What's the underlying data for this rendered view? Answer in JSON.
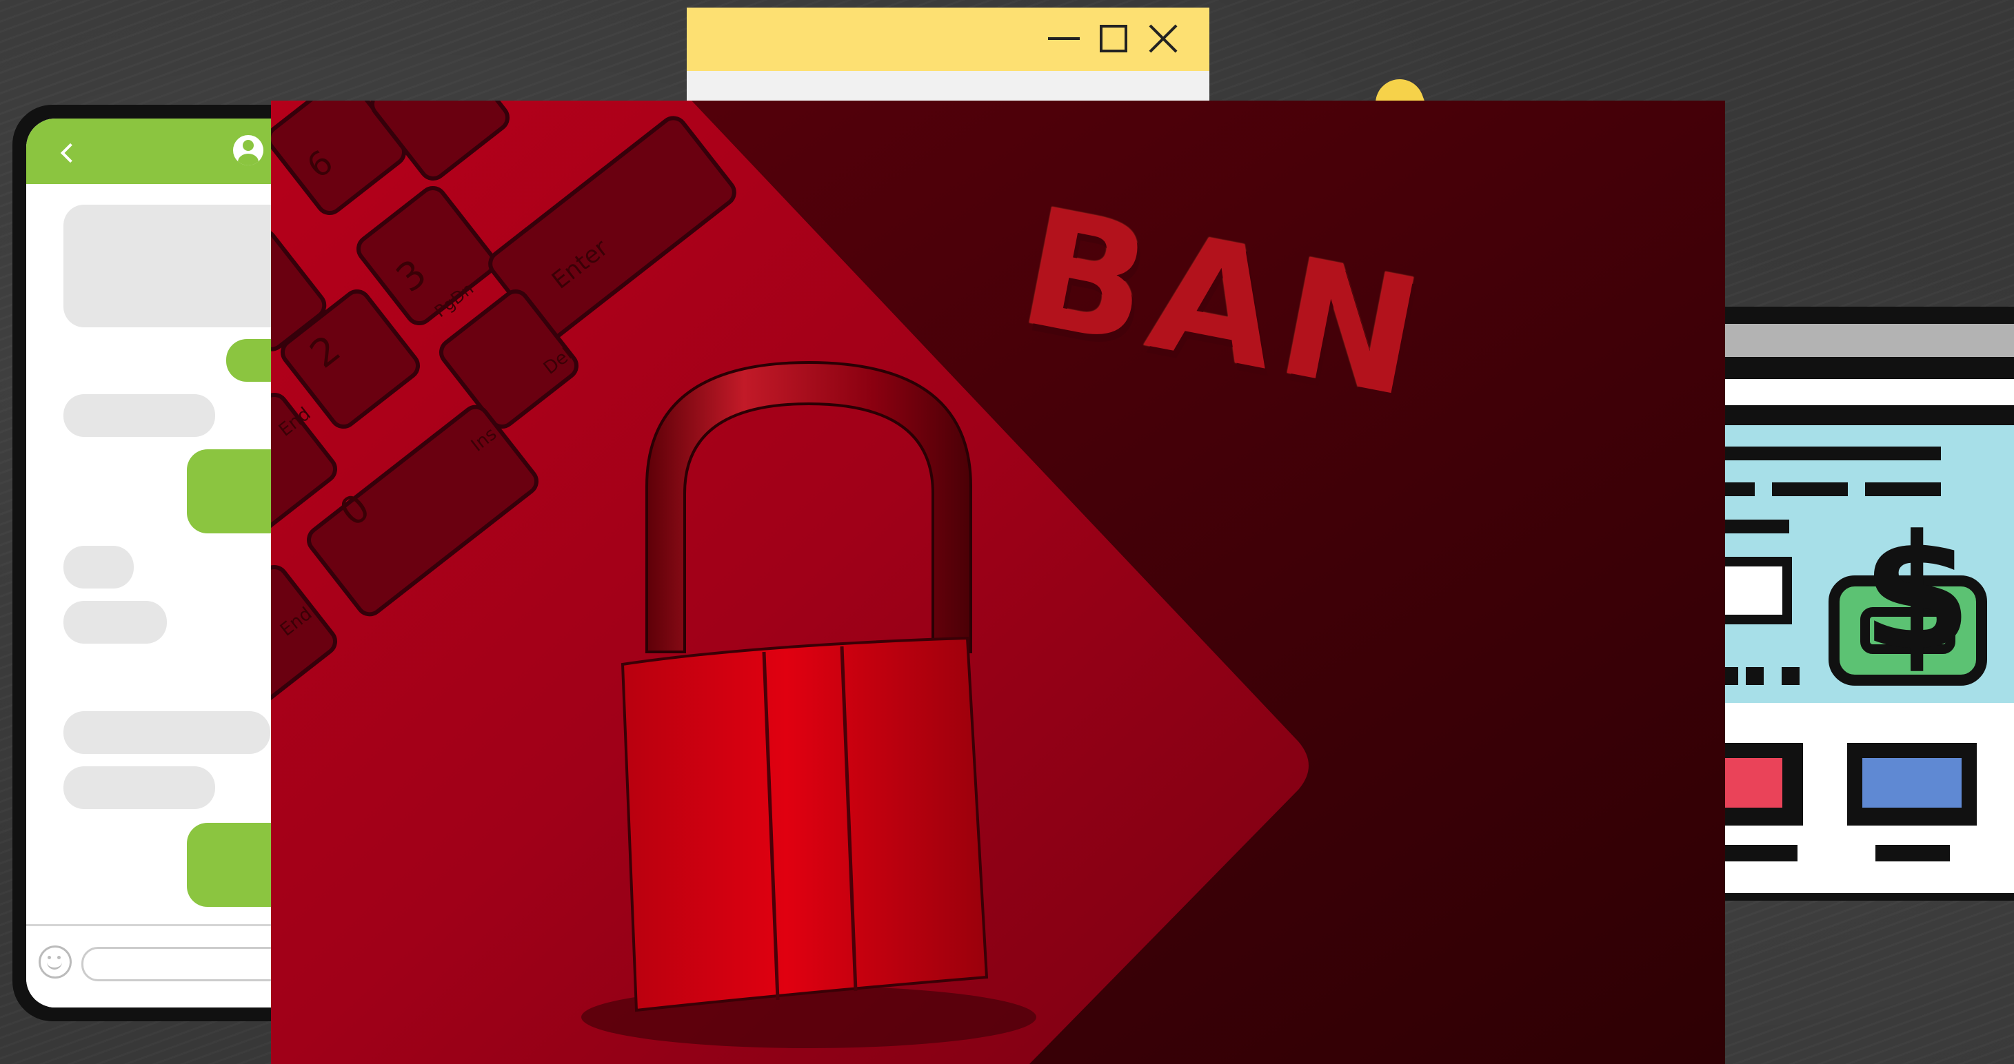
{
  "window": {
    "controls": {
      "minimize": "minimize",
      "maximize": "maximize",
      "close": "close"
    }
  },
  "photo": {
    "text": "BAN",
    "keys": [
      {
        "label": "6"
      },
      {
        "label": "3"
      },
      {
        "label": "PgDn"
      },
      {
        "label": "Enter"
      },
      {
        "label": "2"
      },
      {
        "label": "Del"
      },
      {
        "label": "End"
      },
      {
        "label": "Ins"
      },
      {
        "label": "0"
      },
      {
        "label": "End"
      }
    ]
  },
  "colors": {
    "title_bar": "#fde072",
    "chat_accent": "#8bc540",
    "photo_tint": "#b3121c",
    "money_green": "#5cc273",
    "banner_blue": "#a7dfe8",
    "button_red": "#ea4359",
    "button_blue": "#5f89d3"
  },
  "icons": {
    "back": "chevron-left-icon",
    "avatar": "user-avatar-icon",
    "emoji": "smiley-icon",
    "dollar": "dollar-sign-icon",
    "padlock": "padlock-icon"
  }
}
